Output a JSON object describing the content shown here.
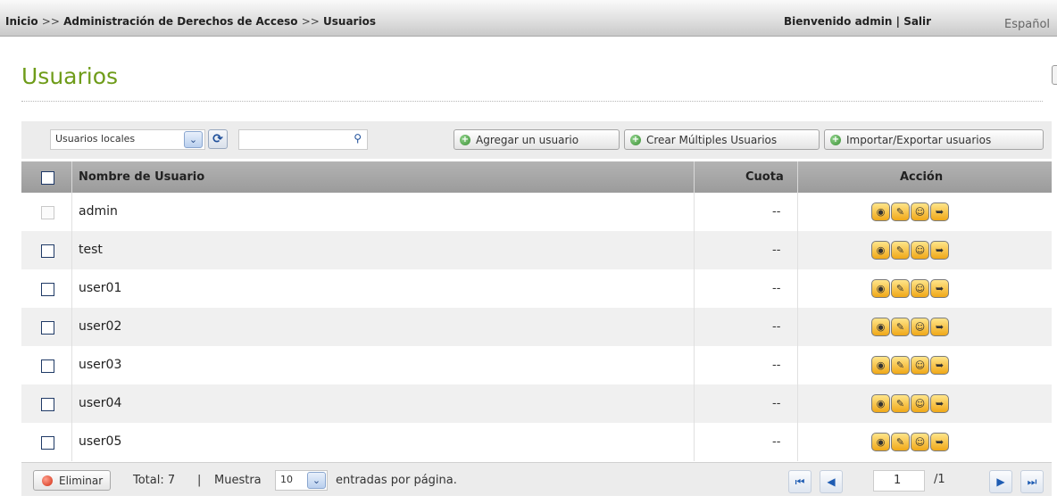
{
  "breadcrumb": {
    "home": "Inicio",
    "sep1": ">>",
    "section": "Administración de Derechos de Acceso",
    "sep2": ">>",
    "current": "Usuarios"
  },
  "session": {
    "welcome": "Bienvenido admin",
    "divider": "|",
    "logout": "Salir"
  },
  "language": "Español",
  "page_title": "Usuarios",
  "toolbar": {
    "user_type_selected": "Usuarios locales",
    "search_value": "",
    "add_user": "Agregar un usuario",
    "create_multiple": "Crear Múltiples Usuarios",
    "import_export": "Importar/Exportar usuarios"
  },
  "table": {
    "columns": {
      "name": "Nombre de Usuario",
      "quota": "Cuota",
      "action": "Acción"
    },
    "rows": [
      {
        "name": "admin",
        "quota": "--"
      },
      {
        "name": "test",
        "quota": "--"
      },
      {
        "name": "user01",
        "quota": "--"
      },
      {
        "name": "user02",
        "quota": "--"
      },
      {
        "name": "user03",
        "quota": "--"
      },
      {
        "name": "user04",
        "quota": "--"
      },
      {
        "name": "user05",
        "quota": "--"
      }
    ]
  },
  "footer": {
    "delete": "Eliminar",
    "total": "Total: 7",
    "divider": "|",
    "show": "Muestra",
    "per_page_value": "10",
    "entries_label": "entradas por página.",
    "page_current": "1",
    "page_total": "/1"
  },
  "icons": {
    "action_buttons": [
      "key-icon",
      "edit-icon",
      "group-icon",
      "folder-permission-icon"
    ],
    "pager": [
      "first-page-icon",
      "prev-page-icon",
      "next-page-icon",
      "last-page-icon"
    ]
  }
}
